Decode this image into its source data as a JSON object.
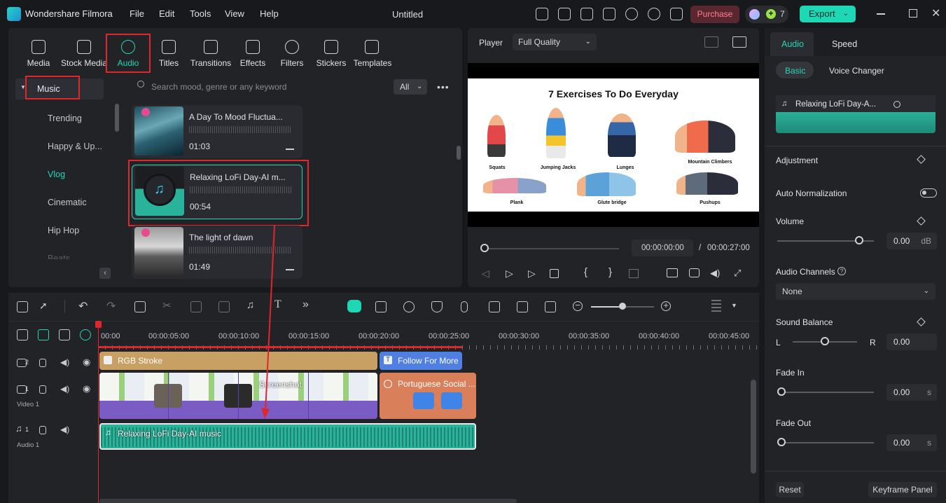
{
  "app": {
    "name": "Wondershare Filmora",
    "project_title": "Untitled",
    "purchase_label": "Purchase",
    "credits": "7",
    "export_label": "Export"
  },
  "menu": [
    "File",
    "Edit",
    "Tools",
    "View",
    "Help"
  ],
  "media_tabs": [
    {
      "label": "Media",
      "icon": "media-icon"
    },
    {
      "label": "Stock Media",
      "icon": "stock-media-icon"
    },
    {
      "label": "Audio",
      "icon": "music-note-icon",
      "active": true
    },
    {
      "label": "Titles",
      "icon": "titles-icon"
    },
    {
      "label": "Transitions",
      "icon": "transitions-icon"
    },
    {
      "label": "Effects",
      "icon": "effects-icon"
    },
    {
      "label": "Filters",
      "icon": "filters-icon"
    },
    {
      "label": "Stickers",
      "icon": "stickers-icon"
    },
    {
      "label": "Templates",
      "icon": "templates-icon"
    }
  ],
  "sidebar": {
    "header": "Music",
    "items": [
      "Trending",
      "Happy & Up...",
      "Vlog",
      "Cinematic",
      "Hip Hop",
      "Beats"
    ],
    "active": "Vlog"
  },
  "search": {
    "placeholder": "Search mood, genre or any keyword",
    "filter": "All"
  },
  "audio_list": [
    {
      "title": "A Day To Mood Fluctua...",
      "duration": "01:03",
      "premium": true
    },
    {
      "title": "Relaxing LoFi Day-AI m...",
      "duration": "00:54",
      "selected": true
    },
    {
      "title": "The light of dawn",
      "duration": "01:49",
      "premium": true
    }
  ],
  "player": {
    "label": "Player",
    "quality": "Full Quality",
    "current_time": "00:00:00:00",
    "separator": "/",
    "total_time": "00:00:27:00"
  },
  "video": {
    "title": "7 Exercises To Do Everyday",
    "exercises": [
      "Squats",
      "Jumping Jacks",
      "Lunges",
      "Mountain Climbers",
      "Plank",
      "Glute bridge",
      "Pushups"
    ]
  },
  "right_panel": {
    "tabs": [
      "Audio",
      "Speed"
    ],
    "subtabs": [
      "Basic",
      "Voice Changer"
    ],
    "clip_name": "Relaxing LoFi Day-A...",
    "adjustment": "Adjustment",
    "auto_normalization": "Auto Normalization",
    "volume": {
      "label": "Volume",
      "value": "0.00",
      "unit": "dB",
      "level": 0.85
    },
    "audio_channels": {
      "label": "Audio Channels",
      "value": "None"
    },
    "sound_balance": {
      "label": "Sound Balance",
      "left": "L",
      "right": "R",
      "value": "0.00",
      "level": 0.5
    },
    "fade_in": {
      "label": "Fade In",
      "value": "0.00",
      "unit": "s"
    },
    "fade_out": {
      "label": "Fade Out",
      "value": "0.00",
      "unit": "s"
    },
    "reset": "Reset",
    "keyframe_panel": "Keyframe Panel"
  },
  "timeline": {
    "ruler": [
      "00:00",
      "00:00:05:00",
      "00:00:10:00",
      "00:00:15:00",
      "00:00:20:00",
      "00:00:25:00",
      "00:00:30:00",
      "00:00:35:00",
      "00:00:40:00",
      "00:00:45:00"
    ],
    "tracks": [
      {
        "num": "2",
        "label": ""
      },
      {
        "num": "1",
        "label": "Video 1"
      },
      {
        "num": "1",
        "label": "Audio 1"
      }
    ],
    "clips": {
      "title1": "RGB Stroke",
      "title2": "Follow For More",
      "video_screenshot": "Screenshot",
      "video_portuguese": "Portuguese Social ...",
      "audio": "Relaxing LoFi Day-AI music"
    }
  },
  "colors": {
    "accent": "#25d6b6",
    "highlight_red": "#e1262d",
    "title_clip": "#c9a063",
    "follow_clip": "#4f7fe0",
    "portuguese_clip": "#d9805a",
    "audio_clip": "#2ab39b",
    "video_clip": "#7b5cc4"
  }
}
